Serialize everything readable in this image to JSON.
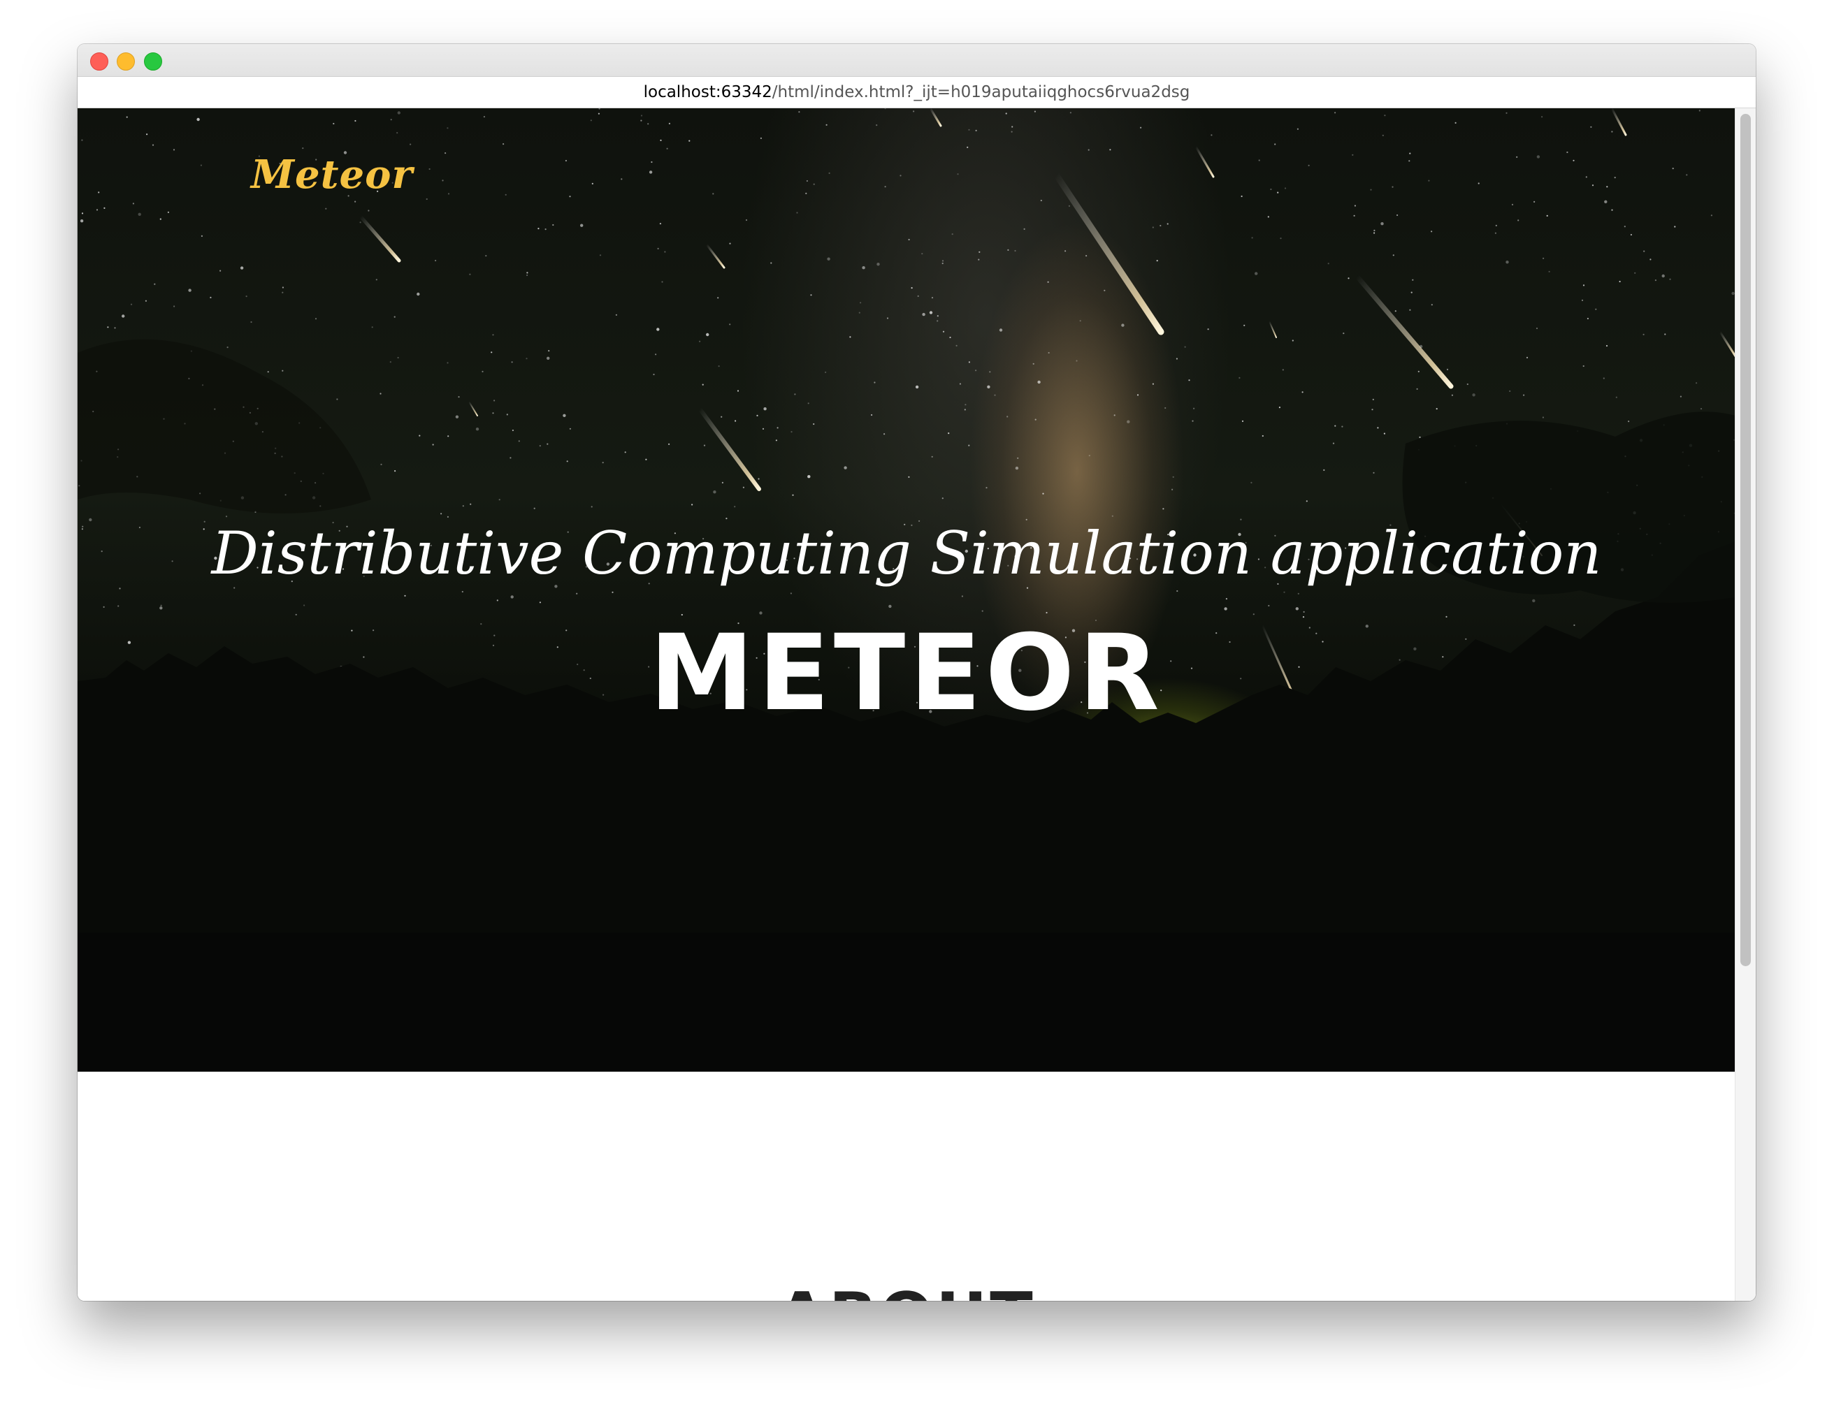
{
  "browser": {
    "url_host": "localhost:63342",
    "url_path": "/html/index.html?_ijt=h019aputaiiqghocs6rvua2dsg"
  },
  "hero": {
    "brand": "Meteor",
    "subtitle": "Distributive Computing Simulation application",
    "headline": "METEOR"
  },
  "sections": {
    "about_heading": "ABOUT"
  },
  "colors": {
    "brand": "#f5c242",
    "hero_text": "#ffffff",
    "sky_glow": "#a8be28"
  }
}
